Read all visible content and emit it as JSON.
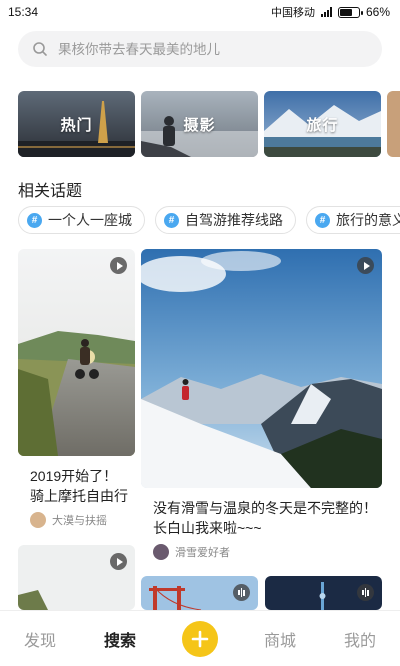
{
  "status_bar": {
    "time": "15:34",
    "carrier": "中国移动",
    "battery": "66%",
    "battery_level": 0.66
  },
  "search": {
    "placeholder": "果核你带去春天最美的地儿"
  },
  "categories": [
    {
      "label": "热门"
    },
    {
      "label": "摄影"
    },
    {
      "label": "旅行"
    }
  ],
  "topics_section": {
    "title": "相关话题",
    "items": [
      {
        "icon": "hash-icon",
        "label": "一个人一座城"
      },
      {
        "icon": "hash-icon",
        "label": "自驾游推荐线路"
      },
      {
        "icon": "hash-icon",
        "label": "旅行的意义"
      }
    ]
  },
  "feed": {
    "card1": {
      "title_line1": "2019开始了！",
      "title_line2": "骑上摩托自由行",
      "author": "大漠与扶摇",
      "media": "video"
    },
    "card2": {
      "title_line1": "没有滑雪与温泉的冬天是不完整的！",
      "title_line2": "长白山我来啦~~~",
      "author": "滑雪爱好者",
      "media": "video"
    },
    "card3": {
      "media": "video"
    },
    "card4": {
      "media": "audio"
    },
    "card5": {
      "media": "audio"
    }
  },
  "bottom_nav": {
    "discover": "发现",
    "search": "搜索",
    "shop": "商城",
    "mine": "我的",
    "accent": "#f5c518"
  }
}
